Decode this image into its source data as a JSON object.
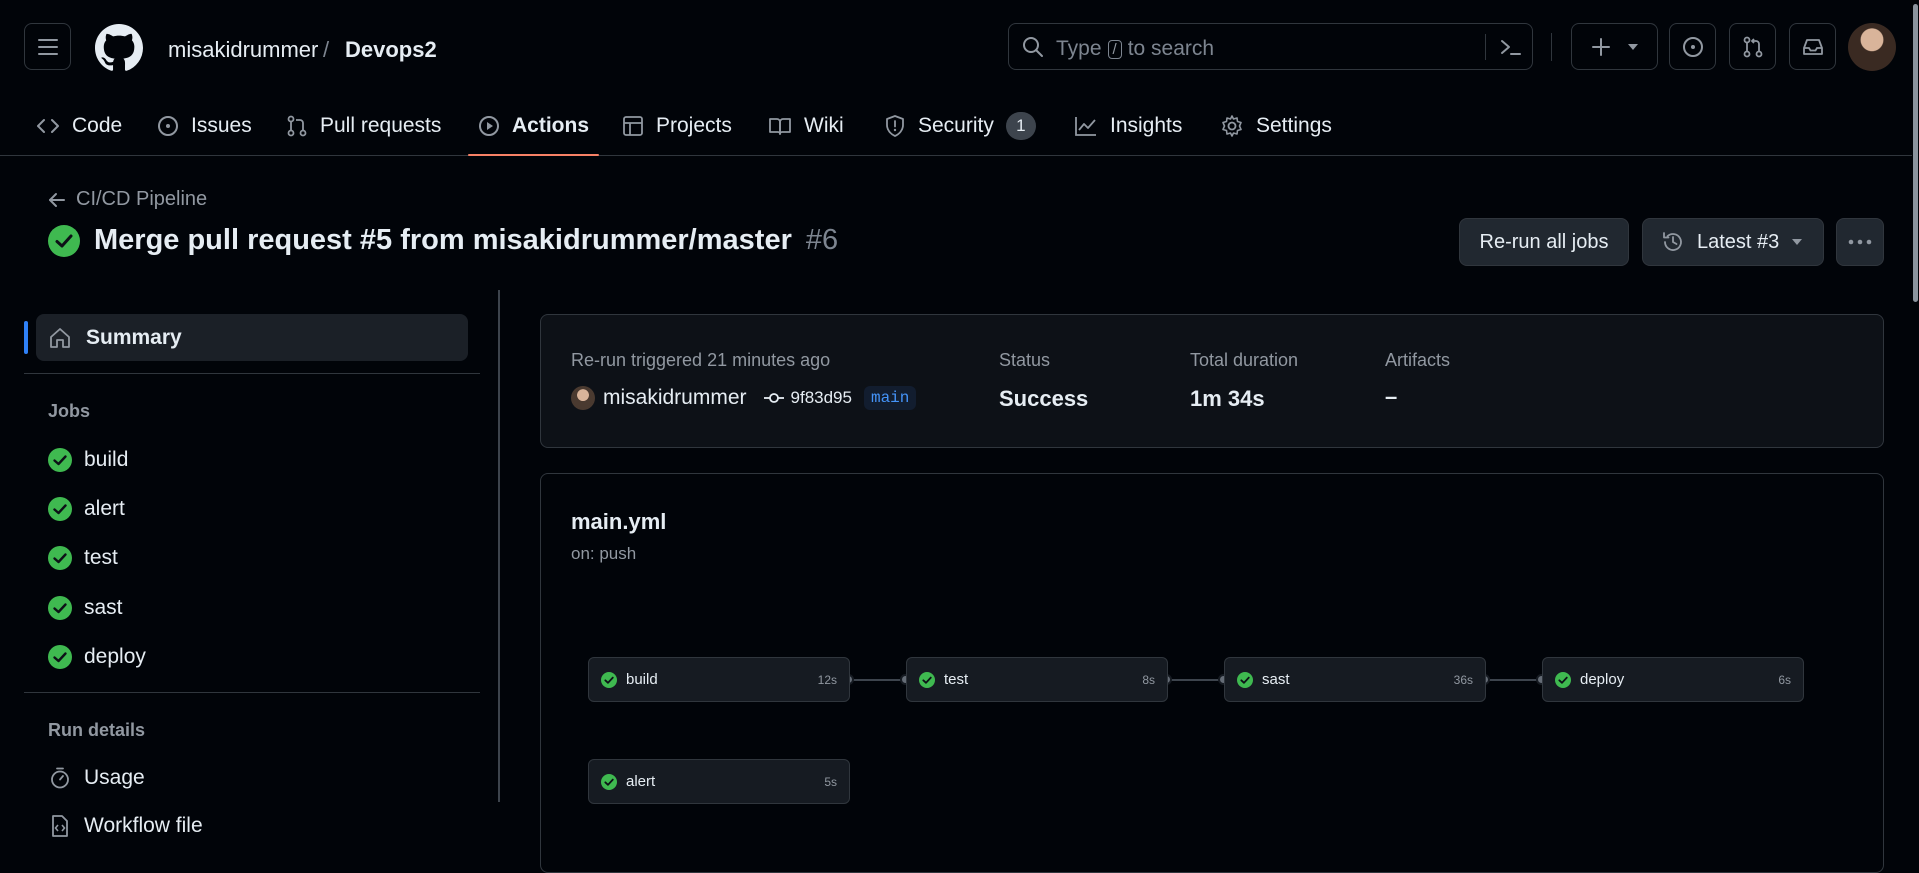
{
  "header": {
    "owner": "misakidrummer",
    "separator": "/",
    "repo": "Devops2",
    "search_prefix": "Type",
    "search_key": "/",
    "search_suffix": "to search"
  },
  "nav": {
    "tabs": [
      {
        "label": "Code",
        "icon": "code-icon"
      },
      {
        "label": "Issues",
        "icon": "issue-icon"
      },
      {
        "label": "Pull requests",
        "icon": "pull-request-icon"
      },
      {
        "label": "Actions",
        "icon": "play-icon",
        "active": true
      },
      {
        "label": "Projects",
        "icon": "table-icon"
      },
      {
        "label": "Wiki",
        "icon": "book-icon"
      },
      {
        "label": "Security",
        "icon": "shield-icon",
        "count": "1"
      },
      {
        "label": "Insights",
        "icon": "graph-icon"
      },
      {
        "label": "Settings",
        "icon": "gear-icon"
      }
    ]
  },
  "run": {
    "workflow_link": "CI/CD Pipeline",
    "title": "Merge pull request #5 from misakidrummer/master",
    "number": "#6",
    "rerun_label": "Re-run all jobs",
    "attempt_label": "Latest #3"
  },
  "sidebar": {
    "summary_label": "Summary",
    "jobs_heading": "Jobs",
    "jobs": [
      "build",
      "alert",
      "test",
      "sast",
      "deploy"
    ],
    "run_details_heading": "Run details",
    "usage_label": "Usage",
    "workflow_file_label": "Workflow file"
  },
  "summary": {
    "trigger_label": "Re-run triggered 21 minutes ago",
    "actor": "misakidrummer",
    "commit": "9f83d95",
    "branch": "main",
    "status_label": "Status",
    "status_value": "Success",
    "duration_label": "Total duration",
    "duration_value": "1m 34s",
    "artifacts_label": "Artifacts",
    "artifacts_value": "–"
  },
  "workflow": {
    "file": "main.yml",
    "trigger": "on: push",
    "jobs": [
      {
        "name": "build",
        "duration": "12s"
      },
      {
        "name": "test",
        "duration": "8s"
      },
      {
        "name": "sast",
        "duration": "36s"
      },
      {
        "name": "deploy",
        "duration": "6s"
      },
      {
        "name": "alert",
        "duration": "5s"
      }
    ]
  },
  "colors": {
    "success": "#3fb950",
    "accent_underline": "#f78166",
    "link_blue": "#4493f8"
  }
}
